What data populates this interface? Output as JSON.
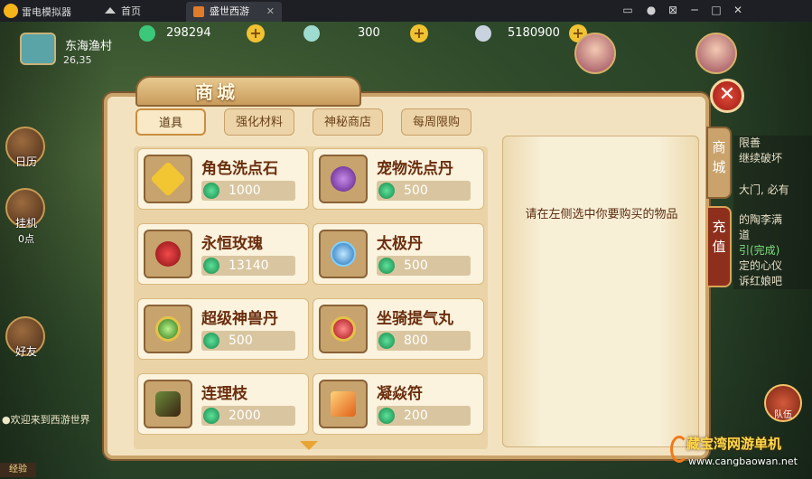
{
  "titlebar": {
    "app_name": "雷电模拟器",
    "tabs": [
      {
        "label": "首页"
      },
      {
        "label": "盛世西游"
      }
    ],
    "close_glyph": "✕",
    "window_controls": [
      "▭",
      "●",
      "⊠",
      "─",
      "□",
      "✕"
    ]
  },
  "resources": [
    {
      "icon": "jade-coin-icon",
      "value": "298294",
      "color": "#3cc87a"
    },
    {
      "icon": "ingot-icon",
      "value": "300",
      "color": "#9fdcd0"
    },
    {
      "icon": "silver-coin-icon",
      "value": "5180900",
      "color": "#c9d3e0"
    }
  ],
  "location": {
    "name": "东海渔村",
    "coords": "26,35"
  },
  "sidebar": [
    {
      "label": "日历"
    },
    {
      "label": "挂机"
    },
    {
      "label": "0点"
    },
    {
      "label": "好友"
    }
  ],
  "chat": {
    "line": "●欢迎来到西游世界"
  },
  "exp_label": "经验",
  "quest_lines": [
    "限善",
    "继续破坏",
    "大门, 必有",
    "的陶李满",
    "道",
    "引(完成)",
    "定的心仪",
    "诉红娘吧"
  ],
  "team_label": "队伍",
  "shop": {
    "title": "商城",
    "close_glyph": "✕",
    "tabs": [
      {
        "label": "道具",
        "active": true
      },
      {
        "label": "强化材料",
        "active": false
      },
      {
        "label": "神秘商店",
        "active": false
      },
      {
        "label": "每周限购",
        "active": false
      }
    ],
    "items": [
      {
        "name": "角色洗点石",
        "price": "1000",
        "icon": "star-stone-icon",
        "color": "#f2c533"
      },
      {
        "name": "宠物洗点丹",
        "price": "500",
        "icon": "purple-pill-icon",
        "color": "#7a3fa6"
      },
      {
        "name": "永恒玫瑰",
        "price": "13140",
        "icon": "rose-icon",
        "color": "#d0242a"
      },
      {
        "name": "太极丹",
        "price": "500",
        "icon": "taiji-pill-icon",
        "color": "#3aa0e0"
      },
      {
        "name": "超级神兽丹",
        "price": "500",
        "icon": "beast-pill-icon",
        "color": "#6cc040"
      },
      {
        "name": "坐骑提气丸",
        "price": "800",
        "icon": "mount-pill-icon",
        "color": "#d83a3a"
      },
      {
        "name": "连理枝",
        "price": "2000",
        "icon": "branch-icon",
        "color": "#4a8a3a"
      },
      {
        "name": "凝焱符",
        "price": "200",
        "icon": "flame-talisman-icon",
        "color": "#e88a2a"
      }
    ],
    "detail_hint": "请在左侧选中你要购买的物品",
    "side_tabs": [
      {
        "label": "商城"
      },
      {
        "label": "充值"
      }
    ]
  },
  "watermark": {
    "name": "藏宝湾网游单机",
    "url": "www.cangbaowan.net"
  }
}
